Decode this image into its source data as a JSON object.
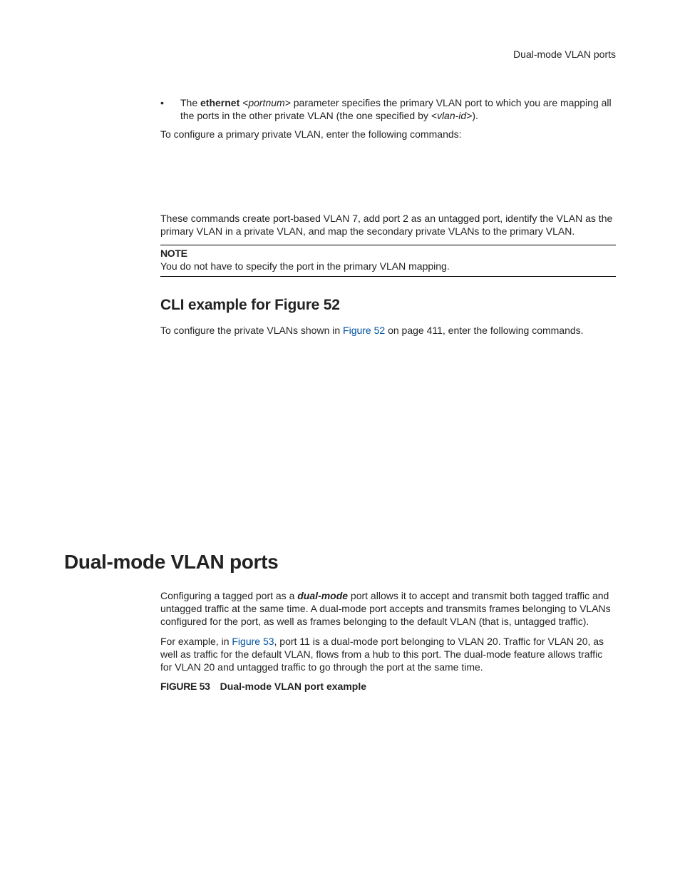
{
  "header": {
    "running_title": "Dual-mode VLAN ports"
  },
  "bullet": {
    "pre": "The ",
    "kw": "ethernet ",
    "arg": "<portnum>",
    "mid": " parameter specifies the primary VLAN port to which you are mapping all the ports in the other private VLAN (the one specified by ",
    "arg2": "<vlan-id>",
    "end": ")."
  },
  "p1": "To configure a primary private VLAN, enter the following commands:",
  "p2": "These commands create port-based VLAN 7, add port 2 as an untagged port, identify the VLAN as the primary VLAN in a private VLAN, and map the secondary private VLANs to the primary VLAN.",
  "note": {
    "label": "NOTE",
    "text": "You do not have to specify the port in the primary VLAN mapping."
  },
  "h2": "CLI example for Figure 52",
  "p3": {
    "pre": "To configure the private VLANs shown in ",
    "link": "Figure 52",
    "post": " on page 411, enter the following commands."
  },
  "h1": "Dual-mode VLAN ports",
  "p4": {
    "pre": "Configuring a tagged port as a ",
    "em": "dual-mode",
    "post": " port allows it to accept and transmit both tagged traffic and untagged traffic at the same time. A dual-mode port accepts and transmits frames belonging to VLANs configured for the port, as well as frames belonging to the default VLAN (that is, untagged traffic)."
  },
  "p5": {
    "pre": "For example, in ",
    "link": "Figure 53",
    "post": ", port 11 is a dual-mode port belonging to VLAN 20. Traffic for VLAN 20, as well as traffic for the default VLAN, flows from a hub to this port. The dual-mode feature allows traffic for VLAN 20 and untagged traffic to go through the port at the same time."
  },
  "figure": {
    "label": "FIGURE 53",
    "caption": "Dual-mode VLAN port example"
  }
}
